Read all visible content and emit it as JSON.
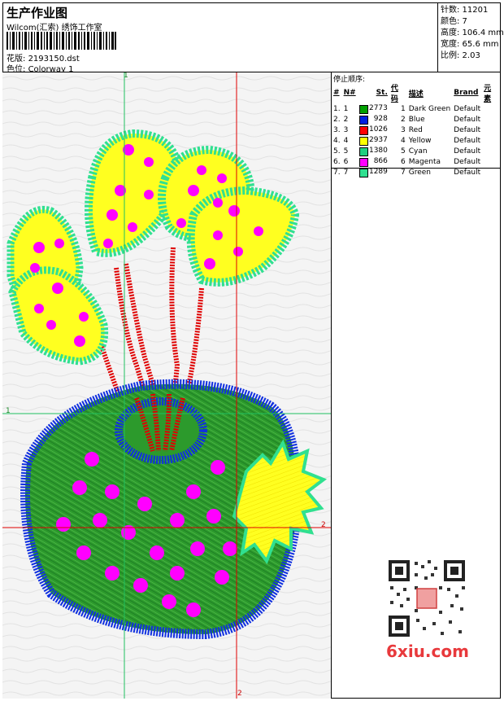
{
  "header": {
    "title": "生产作业图",
    "studio": "Wilcom(汇索) 绣饰工作室",
    "design_label": "花版:",
    "design_value": "2193150.dst",
    "colorway_label": "色位:",
    "colorway_value": "Colorway 1"
  },
  "info": {
    "stitches": "针数: 11201",
    "colors": "颜色: 7",
    "height": "高度: 106.4 mm",
    "width": "宽度: 65.6 mm",
    "scale": "比例: 2.03"
  },
  "stop_sequence": {
    "title": "停止顺序:",
    "columns": [
      "#",
      "N#",
      "St.",
      "代码",
      "描述",
      "Brand",
      "元素"
    ],
    "rows": [
      {
        "idx": "1.",
        "n": "1",
        "color": "#00a000",
        "st": "2773",
        "code": "1",
        "desc": "Dark Green",
        "brand": "Default"
      },
      {
        "idx": "2.",
        "n": "2",
        "color": "#0020e0",
        "st": "928",
        "code": "2",
        "desc": "Blue",
        "brand": "Default"
      },
      {
        "idx": "3.",
        "n": "3",
        "color": "#ff0000",
        "st": "1026",
        "code": "3",
        "desc": "Red",
        "brand": "Default"
      },
      {
        "idx": "4.",
        "n": "4",
        "color": "#ffff00",
        "st": "2937",
        "code": "4",
        "desc": "Yellow",
        "brand": "Default"
      },
      {
        "idx": "5.",
        "n": "5",
        "color": "#20d080",
        "st": "1380",
        "code": "5",
        "desc": "Cyan",
        "brand": "Default"
      },
      {
        "idx": "6.",
        "n": "6",
        "color": "#ff00ff",
        "st": "866",
        "code": "6",
        "desc": "Magenta",
        "brand": "Default"
      },
      {
        "idx": "7.",
        "n": "7",
        "color": "#30e090",
        "st": "1289",
        "code": "7",
        "desc": "Green",
        "brand": "Default"
      }
    ]
  },
  "guides": {
    "top": "1",
    "left": "1",
    "right": "2",
    "bottom": "2"
  },
  "watermark": "6xiu.com"
}
